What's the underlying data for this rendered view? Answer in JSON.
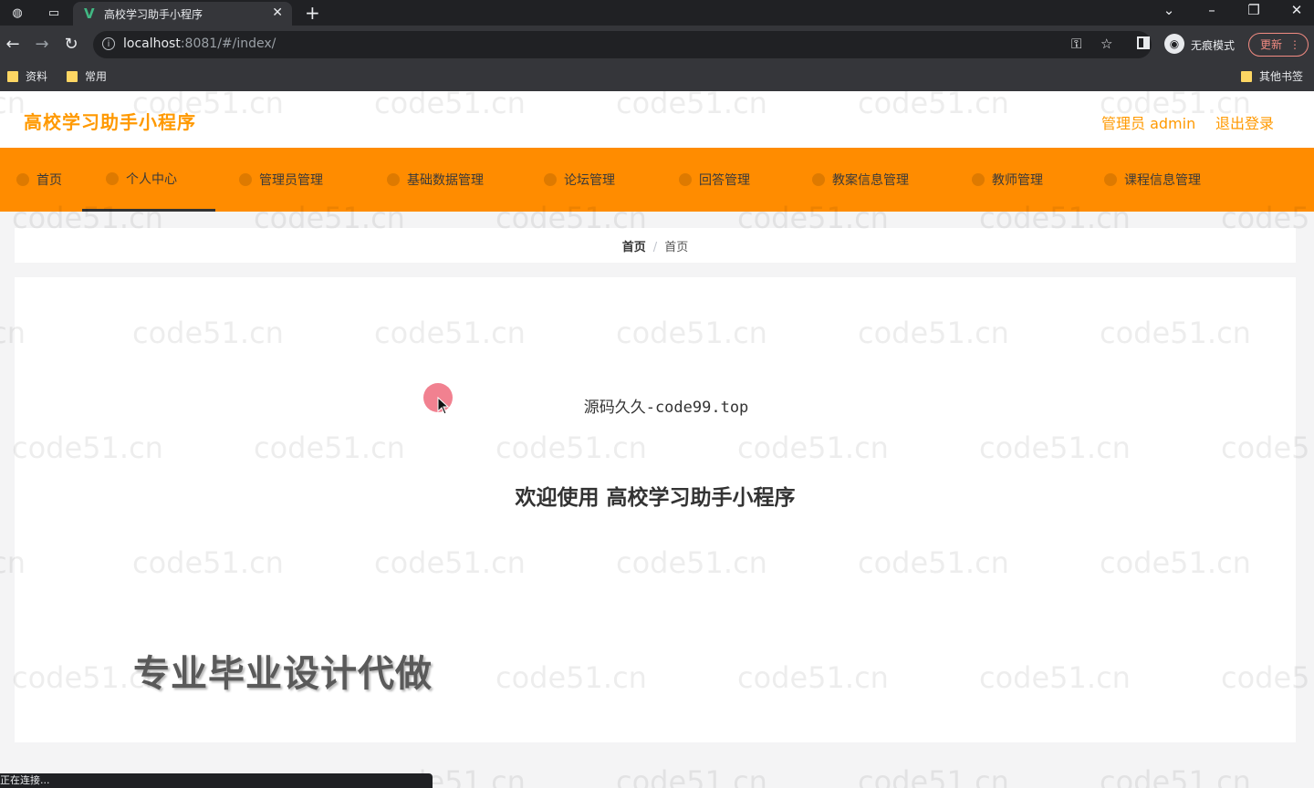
{
  "browser": {
    "tab_title": "高校学习助手小程序",
    "tab_favicon": "V",
    "url_host": "localhost",
    "url_rest": ":8081/#/index/",
    "incognito_label": "无痕模式",
    "update_label": "更新",
    "bookmarks": [
      "资料",
      "常用"
    ],
    "other_bookmarks": "其他书签",
    "status_text": "正在连接..."
  },
  "header": {
    "app_title": "高校学习助手小程序",
    "user_label": "管理员 admin",
    "logout": "退出登录"
  },
  "menu": {
    "items": [
      "首页",
      "个人中心",
      "管理员管理",
      "基础数据管理",
      "论坛管理",
      "回答管理",
      "教案信息管理",
      "教师管理",
      "课程信息管理"
    ]
  },
  "breadcrumb": {
    "home": "首页",
    "current": "首页"
  },
  "content": {
    "source_text": "源码久久-code99.top",
    "welcome_prefix": "欢迎使用",
    "welcome_name": "高校学习助手小程序",
    "promo": "专业毕业设计代做"
  },
  "watermark": "code51.cn",
  "colors": {
    "accent": "#ff8c00",
    "title": "#ff9900"
  }
}
